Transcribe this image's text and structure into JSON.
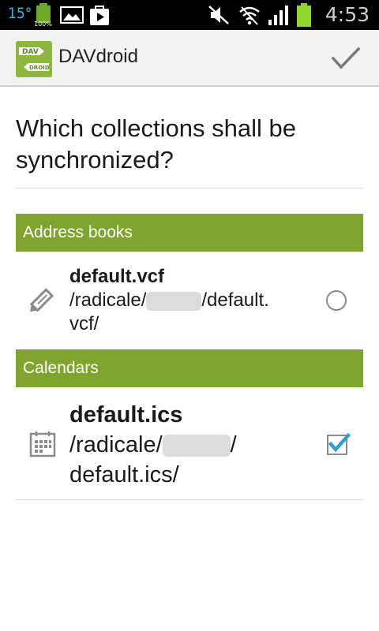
{
  "status_bar": {
    "temperature": "15°",
    "battery_percent": "100%",
    "time": "4:53"
  },
  "action_bar": {
    "app_title": "DAVdroid",
    "app_icon_text_top": "DAV",
    "app_icon_text_bottom": "DROID"
  },
  "question": "Which collections shall be synchronized?",
  "sections": {
    "address_books": {
      "header": "Address books",
      "items": [
        {
          "title": "default.vcf",
          "path_prefix": "/radicale/",
          "path_suffix": "/default.",
          "path_line2": "vcf/",
          "selected": false
        }
      ]
    },
    "calendars": {
      "header": "Calendars",
      "items": [
        {
          "title": "default.ics",
          "path_prefix": "/radicale/",
          "path_suffix": "/",
          "path_line2": "default.ics/",
          "selected": true
        }
      ]
    }
  },
  "colors": {
    "section_header": "#7fa52f",
    "accent_check": "#2f9fd8",
    "status_blue": "#39b6e8",
    "battery_green": "#8fd62a"
  }
}
